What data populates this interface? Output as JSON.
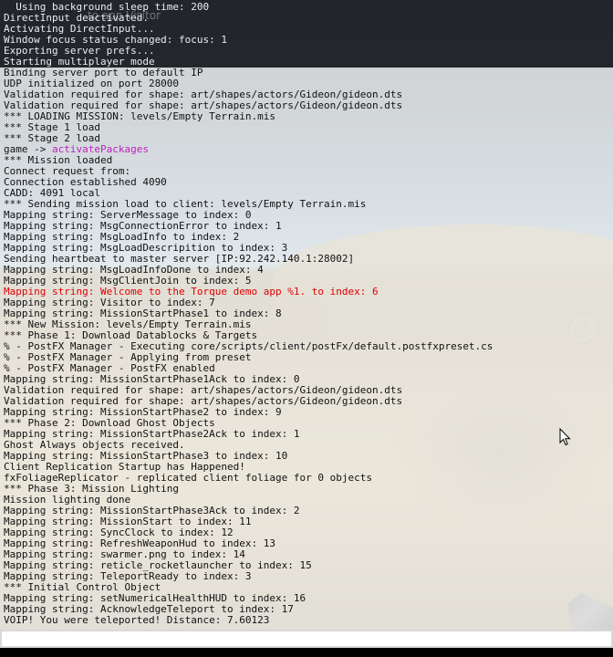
{
  "window": {
    "background_label": "to app Visitor"
  },
  "console": {
    "lines": [
      {
        "text": "  Using background sleep time: 200",
        "style": "light"
      },
      {
        "text": "DirectInput deactivated.",
        "style": "light"
      },
      {
        "text": "Activating DirectInput...",
        "style": "light"
      },
      {
        "text": "Window focus status changed: focus: 1",
        "style": "light"
      },
      {
        "text": "Exporting server prefs...",
        "style": "light"
      },
      {
        "text": "Starting multiplayer mode",
        "style": "light"
      },
      {
        "text": "Binding server port to default IP",
        "style": "normal"
      },
      {
        "text": "UDP initialized on port 28000",
        "style": "normal"
      },
      {
        "text": "Validation required for shape: art/shapes/actors/Gideon/gideon.dts",
        "style": "normal"
      },
      {
        "text": "Validation required for shape: art/shapes/actors/Gideon/gideon.dts",
        "style": "normal"
      },
      {
        "text": "*** LOADING MISSION: levels/Empty Terrain.mis",
        "style": "normal"
      },
      {
        "text": "*** Stage 1 load",
        "style": "normal"
      },
      {
        "text": "*** Stage 2 load",
        "style": "normal"
      },
      {
        "text": "game -> ",
        "accent": "activatePackages",
        "style": "normal"
      },
      {
        "text": "*** Mission loaded",
        "style": "normal"
      },
      {
        "text": "Connect request from:",
        "style": "normal"
      },
      {
        "text": "Connection established 4090",
        "style": "normal"
      },
      {
        "text": "CADD: 4091 local",
        "style": "normal"
      },
      {
        "text": "*** Sending mission load to client: levels/Empty Terrain.mis",
        "style": "normal"
      },
      {
        "text": "Mapping string: ServerMessage to index: 0",
        "style": "normal"
      },
      {
        "text": "Mapping string: MsgConnectionError to index: 1",
        "style": "normal"
      },
      {
        "text": "Mapping string: MsgLoadInfo to index: 2",
        "style": "normal"
      },
      {
        "text": "Mapping string: MsgLoadDescripition to index: 3",
        "style": "normal"
      },
      {
        "text": "Sending heartbeat to master server [IP:92.242.140.1:28002]",
        "style": "normal"
      },
      {
        "text": "Mapping string: MsgLoadInfoDone to index: 4",
        "style": "normal"
      },
      {
        "text": "Mapping string: MsgClientJoin to index: 5",
        "style": "normal"
      },
      {
        "text": "Mapping string: Welcome to the Torque demo app %1. to index: 6",
        "style": "error"
      },
      {
        "text": "Mapping string: Visitor to index: 7",
        "style": "normal"
      },
      {
        "text": "Mapping string: MissionStartPhase1 to index: 8",
        "style": "normal"
      },
      {
        "text": "*** New Mission: levels/Empty Terrain.mis",
        "style": "normal"
      },
      {
        "text": "*** Phase 1: Download Datablocks & Targets",
        "style": "normal"
      },
      {
        "text": "% - PostFX Manager - Executing core/scripts/client/postFx/default.postfxpreset.cs",
        "style": "normal"
      },
      {
        "text": "% - PostFX Manager - Applying from preset",
        "style": "normal"
      },
      {
        "text": "% - PostFX Manager - PostFX enabled",
        "style": "normal"
      },
      {
        "text": "Mapping string: MissionStartPhase1Ack to index: 0",
        "style": "normal"
      },
      {
        "text": "Validation required for shape: art/shapes/actors/Gideon/gideon.dts",
        "style": "normal"
      },
      {
        "text": "Validation required for shape: art/shapes/actors/Gideon/gideon.dts",
        "style": "normal"
      },
      {
        "text": "Mapping string: MissionStartPhase2 to index: 9",
        "style": "normal"
      },
      {
        "text": "*** Phase 2: Download Ghost Objects",
        "style": "normal"
      },
      {
        "text": "Mapping string: MissionStartPhase2Ack to index: 1",
        "style": "normal"
      },
      {
        "text": "Ghost Always objects received.",
        "style": "normal"
      },
      {
        "text": "Mapping string: MissionStartPhase3 to index: 10",
        "style": "normal"
      },
      {
        "text": "Client Replication Startup has Happened!",
        "style": "normal"
      },
      {
        "text": "fxFoliageReplicator - replicated client foliage for 0 objects",
        "style": "normal"
      },
      {
        "text": "*** Phase 3: Mission Lighting",
        "style": "normal"
      },
      {
        "text": "Mission lighting done",
        "style": "normal"
      },
      {
        "text": "Mapping string: MissionStartPhase3Ack to index: 2",
        "style": "normal"
      },
      {
        "text": "Mapping string: MissionStart to index: 11",
        "style": "normal"
      },
      {
        "text": "Mapping string: SyncClock to index: 12",
        "style": "normal"
      },
      {
        "text": "Mapping string: RefreshWeaponHud to index: 13",
        "style": "normal"
      },
      {
        "text": "Mapping string: swarmer.png to index: 14",
        "style": "normal"
      },
      {
        "text": "Mapping string: reticle_rocketlauncher to index: 15",
        "style": "normal"
      },
      {
        "text": "Mapping string: TeleportReady to index: 3",
        "style": "normal"
      },
      {
        "text": "*** Initial Control Object",
        "style": "normal"
      },
      {
        "text": "Mapping string: setNumericalHealthHUD to index: 16",
        "style": "normal"
      },
      {
        "text": "Mapping string: AcknowledgeTeleport to index: 17",
        "style": "normal"
      },
      {
        "text": "VOIP! You were teleported! Distance: 7.60123",
        "style": "normal"
      }
    ],
    "input": {
      "value": "",
      "placeholder": ""
    }
  },
  "colors": {
    "accent_text": "#c020c0",
    "error_text": "#e00000",
    "console_bg": "rgba(255,255,255,0.80)",
    "sky_top": "#0e1a22",
    "sand": "#8d7a43"
  },
  "icons": {
    "cursor": "mouse-pointer-icon",
    "crosshair": "crosshair-ring-icon",
    "weapon": "weapon-icon"
  }
}
